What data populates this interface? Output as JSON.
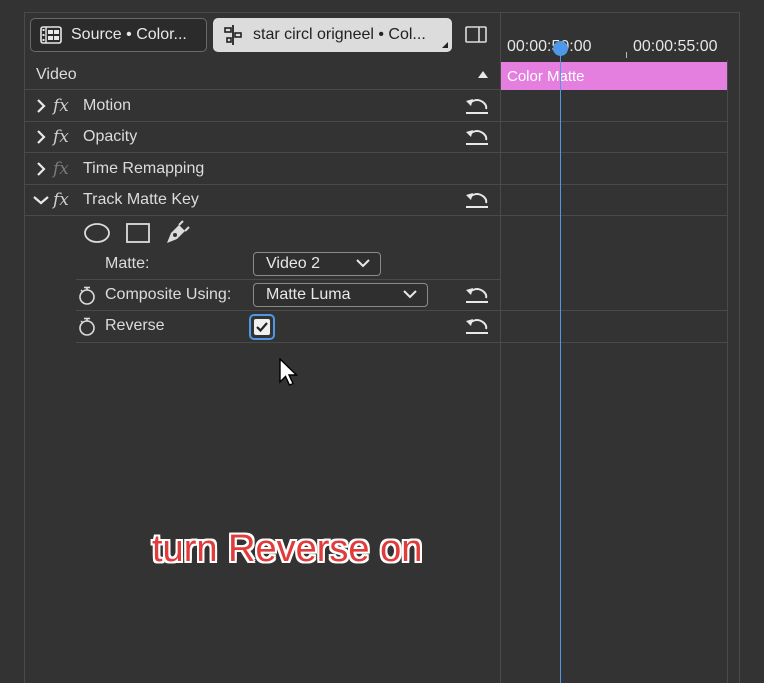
{
  "tabs": [
    {
      "label": "Source • Color...",
      "icon": "film-strip-icon"
    },
    {
      "label": "star circl origneel • Col...",
      "icon": "effect-controls-icon"
    }
  ],
  "panel_toggle_icon": "panel-toggle-icon",
  "video_section": {
    "label": "Video"
  },
  "effects": [
    {
      "label": "Motion",
      "expanded": false,
      "fx_enabled": true
    },
    {
      "label": "Opacity",
      "expanded": false,
      "fx_enabled": true
    },
    {
      "label": "Time Remapping",
      "expanded": false,
      "fx_enabled": false
    },
    {
      "label": "Track Matte Key",
      "expanded": true,
      "fx_enabled": true
    }
  ],
  "mask_tools": [
    "ellipse-mask-icon",
    "rectangle-mask-icon",
    "pen-mask-icon"
  ],
  "params": {
    "matte": {
      "label": "Matte:",
      "value": "Video 2"
    },
    "composite": {
      "label": "Composite Using:",
      "value": "Matte Luma"
    },
    "reverse": {
      "label": "Reverse",
      "checked": true
    }
  },
  "timeline": {
    "timecode_start": "00:00:50:00",
    "timecode_end": "00:00:55:00",
    "clip_label": "Color Matte",
    "clip_color": "#e47fe0",
    "playhead_color": "#4e98e8"
  },
  "annotation": "turn Reverse on"
}
